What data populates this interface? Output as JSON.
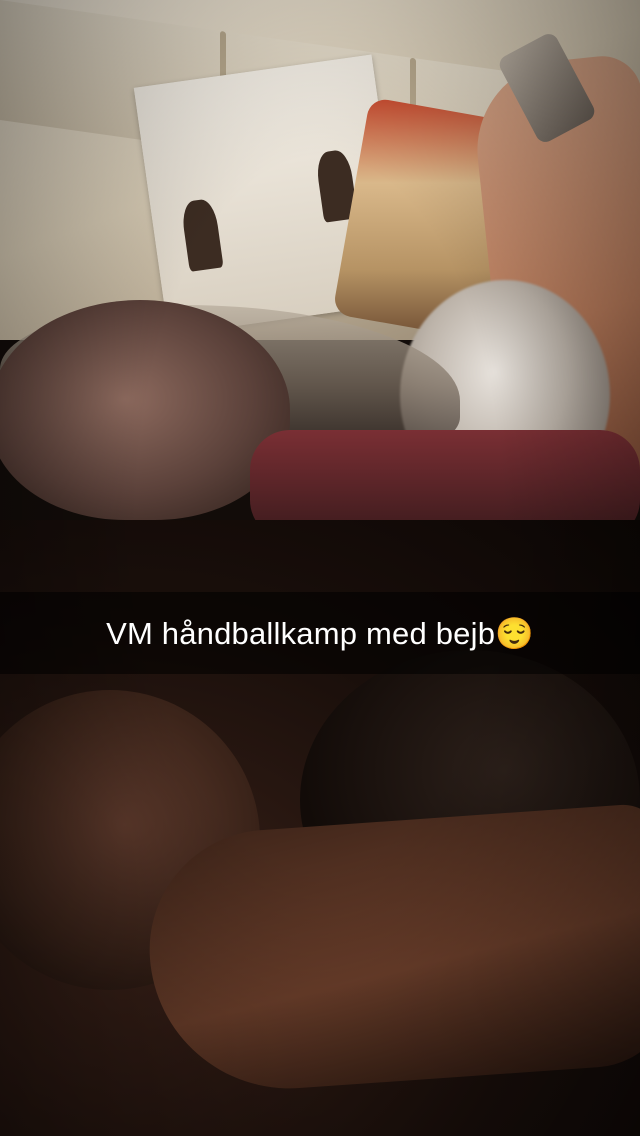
{
  "snap": {
    "caption": {
      "text": "VM håndballkamp med bejb😌"
    }
  },
  "colors": {
    "caption_bar": "#000000",
    "caption_text": "#ffffff"
  }
}
